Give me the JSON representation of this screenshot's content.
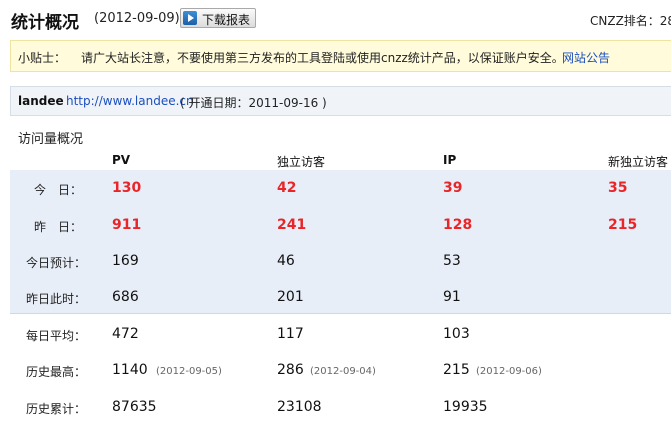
{
  "header": {
    "title": "统计概况",
    "date": "(2012-09-09)",
    "download_label": "下载报表",
    "rank_label": "CNZZ排名：28"
  },
  "tip": {
    "label": "小贴士：",
    "text": "请广大站长注意，不要使用第三方发布的工具登陆或使用cnzz统计产品，以保证账户安全。",
    "link": "网站公告"
  },
  "site": {
    "name": "landee",
    "url": "http://www.landee.cn",
    "open_date": "( 开通日期：2011-09-16 )"
  },
  "section": {
    "title": "访问量概况"
  },
  "columns": [
    "PV",
    "独立访客",
    "IP",
    "新独立访客"
  ],
  "rows": [
    {
      "label": "今　日：",
      "values": [
        "130",
        "42",
        "39",
        "35"
      ]
    },
    {
      "label": "昨　日：",
      "values": [
        "911",
        "241",
        "128",
        "215"
      ]
    },
    {
      "label": "今日预计：",
      "values": [
        "169",
        "46",
        "53",
        ""
      ]
    },
    {
      "label": "昨日此时：",
      "values": [
        "686",
        "201",
        "91",
        ""
      ]
    },
    {
      "label": "每日平均：",
      "values": [
        "472",
        "117",
        "103",
        ""
      ]
    },
    {
      "label": "历史最高：",
      "values": [
        "1140",
        "286",
        "215",
        ""
      ],
      "dates": [
        "(2012-09-05)",
        "(2012-09-04)",
        "(2012-09-06)"
      ]
    },
    {
      "label": "历史累计：",
      "values": [
        "87635",
        "23108",
        "19935",
        ""
      ]
    }
  ]
}
